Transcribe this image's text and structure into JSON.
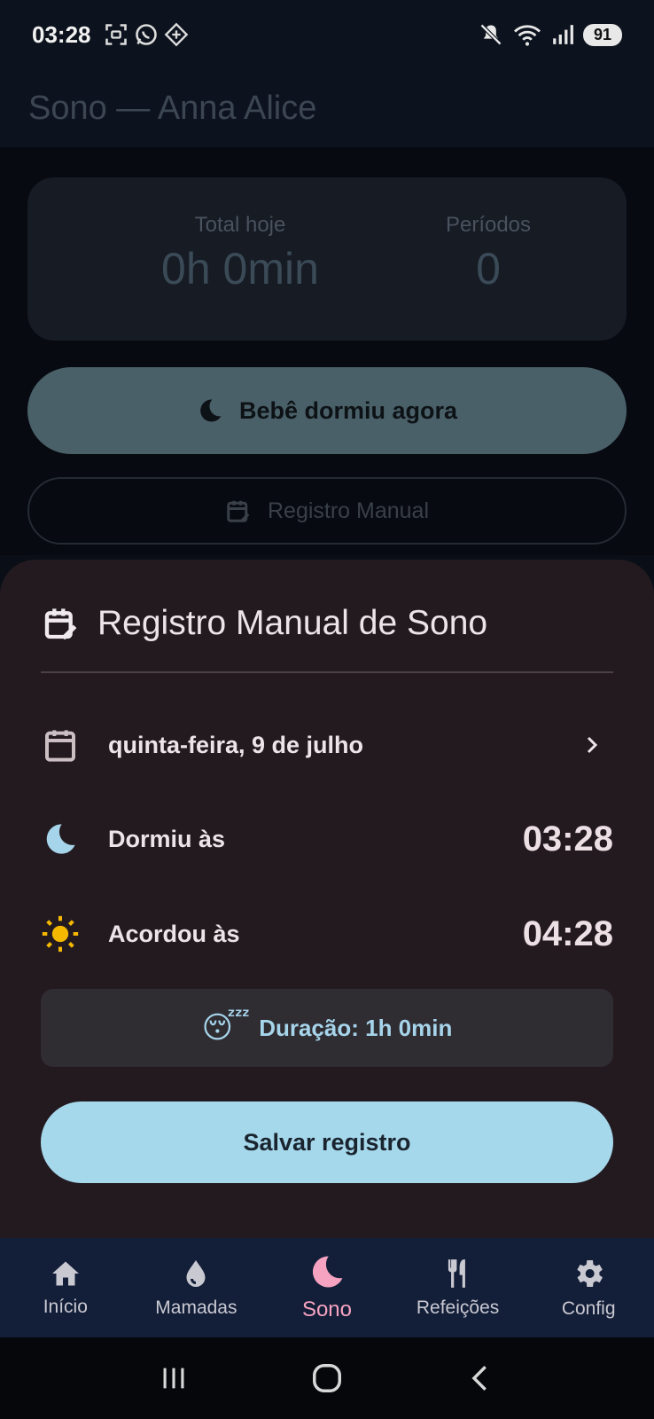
{
  "status_bar": {
    "time": "03:28",
    "battery": "91"
  },
  "appbar": {
    "title": "Sono — Anna Alice"
  },
  "summary": {
    "total_label": "Total hoje",
    "total_value": "0h 0min",
    "periods_label": "Períodos",
    "periods_value": "0"
  },
  "actions": {
    "sleep_now_label": "Bebê dormiu agora",
    "manual_label": "Registro Manual"
  },
  "sheet": {
    "title": "Registro Manual de Sono",
    "date": "quinta-feira, 9 de julho",
    "slept_label": "Dormiu às",
    "slept_time": "03:28",
    "woke_label": "Acordou às",
    "woke_time": "04:28",
    "duration_emoji": "😴",
    "duration_text": "Duração: 1h 0min",
    "save_label": "Salvar registro"
  },
  "nav": {
    "items": [
      {
        "label": "Início",
        "icon": "home-icon"
      },
      {
        "label": "Mamadas",
        "icon": "drop-icon"
      },
      {
        "label": "Sono",
        "icon": "moon-icon",
        "active": true
      },
      {
        "label": "Refeições",
        "icon": "utensils-icon"
      },
      {
        "label": "Config",
        "icon": "gear-icon"
      }
    ]
  },
  "colors": {
    "accent_pink": "#f5a3c0",
    "accent_blue": "#a6d8ec",
    "sheet_bg": "#231a1f",
    "nav_bg": "#131e38"
  }
}
